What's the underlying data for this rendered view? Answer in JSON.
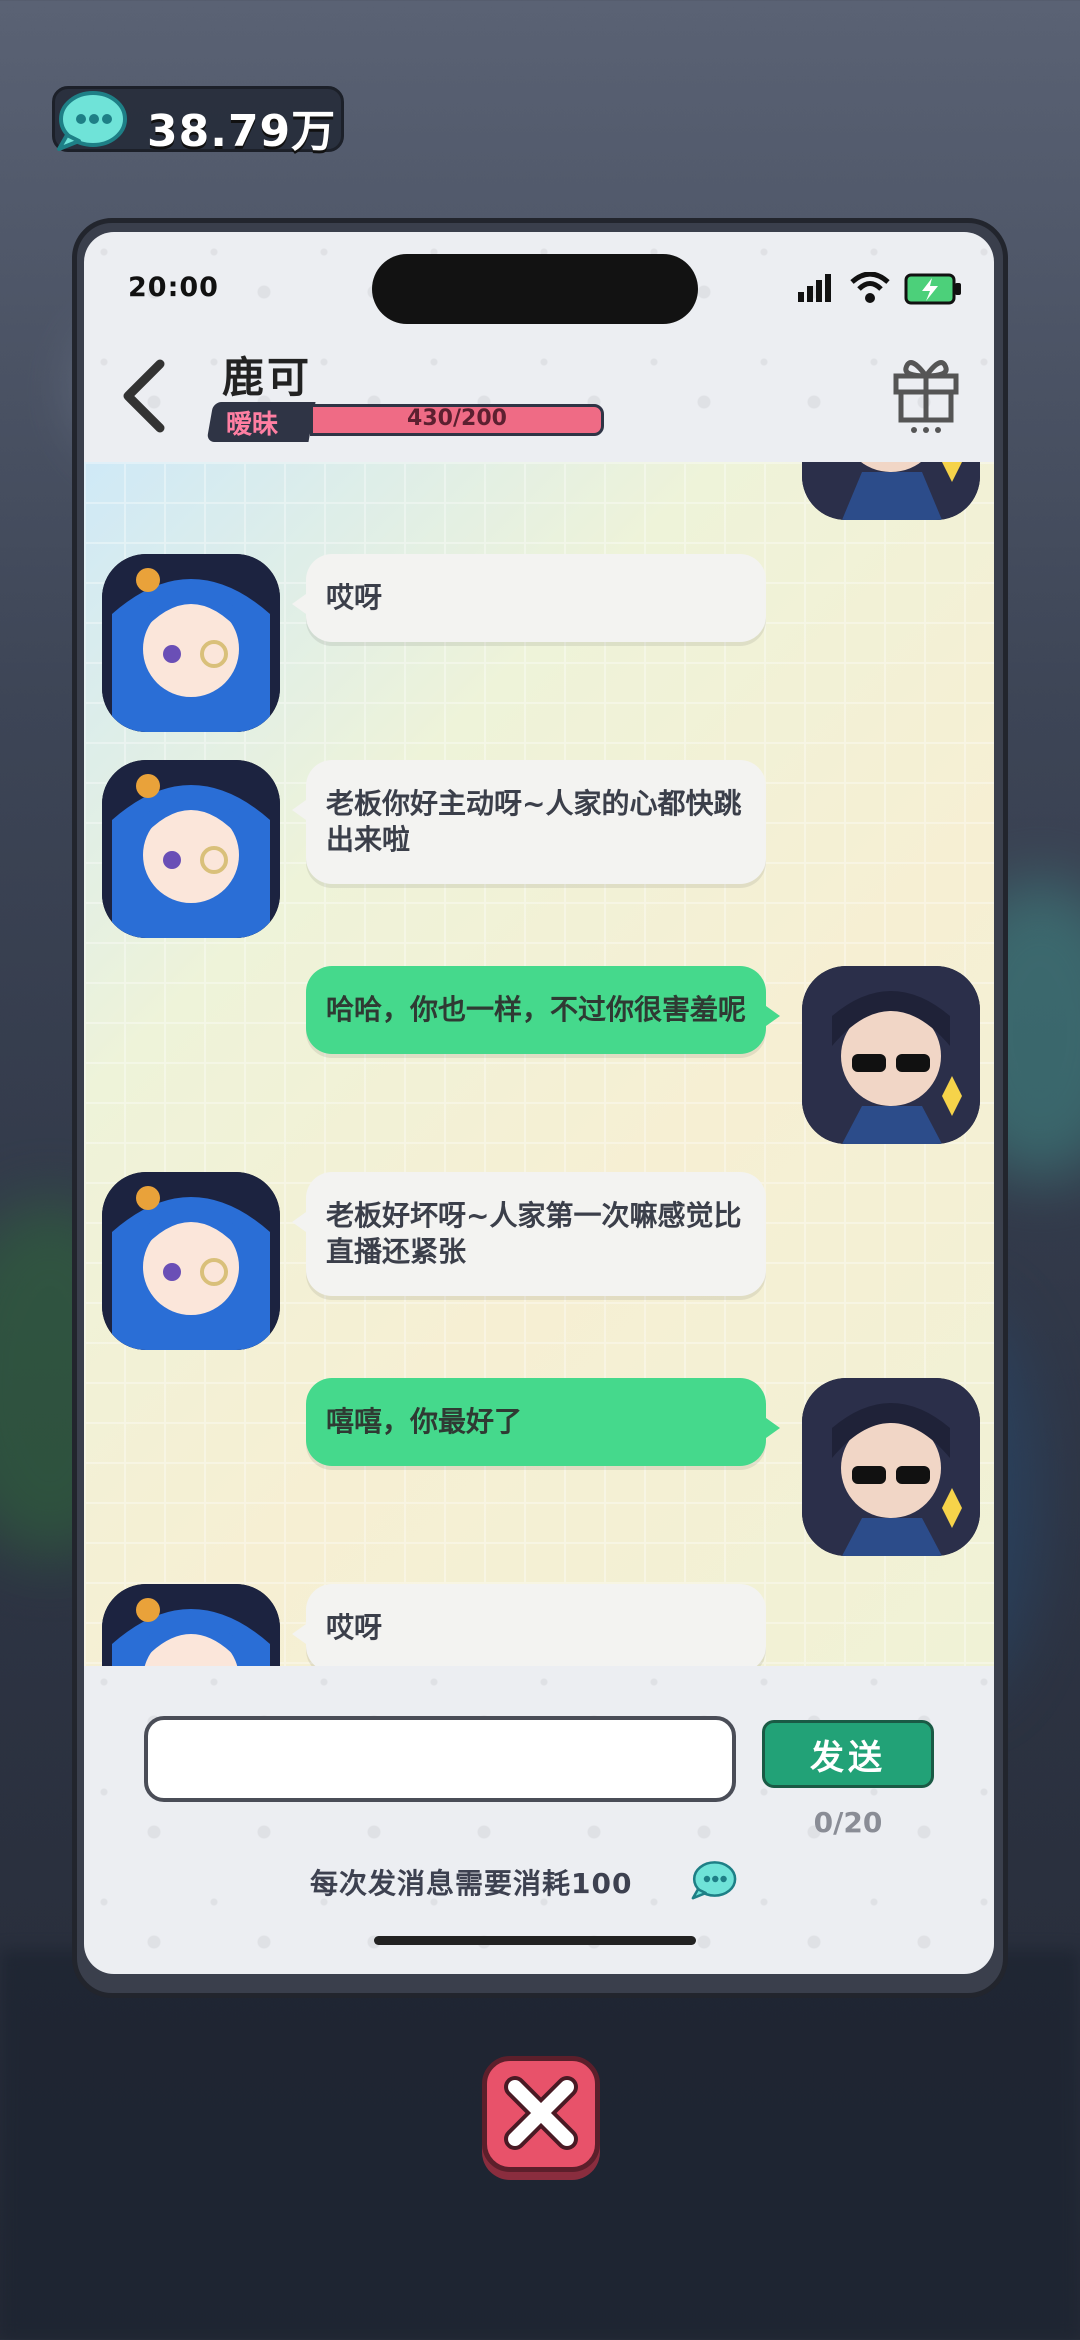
{
  "hud": {
    "currency_value": "38.79万",
    "currency_icon": "chat-bubble-coin-icon"
  },
  "status_bar": {
    "time": "20:00"
  },
  "header": {
    "contact_name": "鹿可",
    "relationship_label": "暧昧",
    "relationship_progress": "430/200",
    "relationship_fill": 1.0
  },
  "messages": [
    {
      "from": "me",
      "text": ""
    },
    {
      "from": "her",
      "text": "哎呀"
    },
    {
      "from": "her",
      "text": "老板你好主动呀~人家的心都快跳出来啦"
    },
    {
      "from": "me",
      "text": "哈哈，你也一样，不过你很害羞呢"
    },
    {
      "from": "her",
      "text": "老板好坏呀~人家第一次嘛感觉比直播还紧张"
    },
    {
      "from": "me",
      "text": "嘻嘻，你最好了"
    },
    {
      "from": "her",
      "text": "哎呀"
    }
  ],
  "composer": {
    "input_value": "",
    "send_label": "发送",
    "char_counter": "0/20",
    "cost_notice": "每次发消息需要消耗100"
  },
  "colors": {
    "accent_green": "#45d98c",
    "send_button": "#22a277",
    "relationship_bar": "#ef6b85",
    "close_button": "#e8526a"
  }
}
